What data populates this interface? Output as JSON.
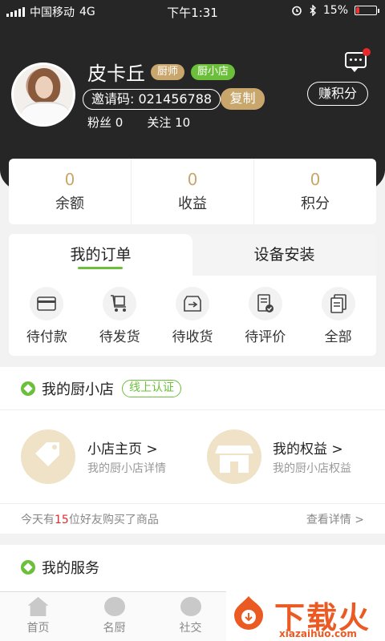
{
  "status_bar": {
    "carrier": "中国移动",
    "network": "4G",
    "time": "下午1:31",
    "battery_percent": "15%",
    "battery_level": 0.15
  },
  "profile": {
    "name": "皮卡丘",
    "tags": [
      "厨师",
      "厨小店"
    ],
    "invite_label": "邀请码: 021456788",
    "copy_label": "复制",
    "fans": "粉丝 0",
    "follows": "关注 10",
    "points_button": "赚积分",
    "has_unread_message": true
  },
  "balance": [
    {
      "value": "0",
      "label": "余额"
    },
    {
      "value": "0",
      "label": "收益"
    },
    {
      "value": "0",
      "label": "积分"
    }
  ],
  "orders": {
    "tabs": [
      "我的订单",
      "设备安装"
    ],
    "items": [
      {
        "label": "待付款",
        "icon": "wallet-card-icon"
      },
      {
        "label": "待发货",
        "icon": "cart-box-icon"
      },
      {
        "label": "待收货",
        "icon": "delivery-box-icon"
      },
      {
        "label": "待评价",
        "icon": "review-check-icon"
      },
      {
        "label": "全部",
        "icon": "all-documents-icon"
      }
    ]
  },
  "shop": {
    "title": "我的厨小店",
    "cert_tag": "线上认证",
    "cards": [
      {
        "title": "小店主页 >",
        "subtitle": "我的厨小店详情",
        "icon": "price-tag-icon"
      },
      {
        "title": "我的权益 >",
        "subtitle": "我的厨小店权益",
        "icon": "storefront-icon"
      }
    ],
    "footer_prefix": "今天有",
    "footer_count": "15",
    "footer_suffix": "位好友购买了商品",
    "footer_link": "查看详情 >"
  },
  "services": {
    "title": "我的服务"
  },
  "tabbar": [
    "首页",
    "名厨",
    "社交"
  ],
  "watermark": {
    "brand": "下载火",
    "url": "xiazaihuo.com"
  },
  "colors": {
    "header": "#262626",
    "gold": "#c9a66b",
    "green": "#6cbf3a",
    "red": "#e62a2a",
    "watermark": "#ec5a23"
  }
}
